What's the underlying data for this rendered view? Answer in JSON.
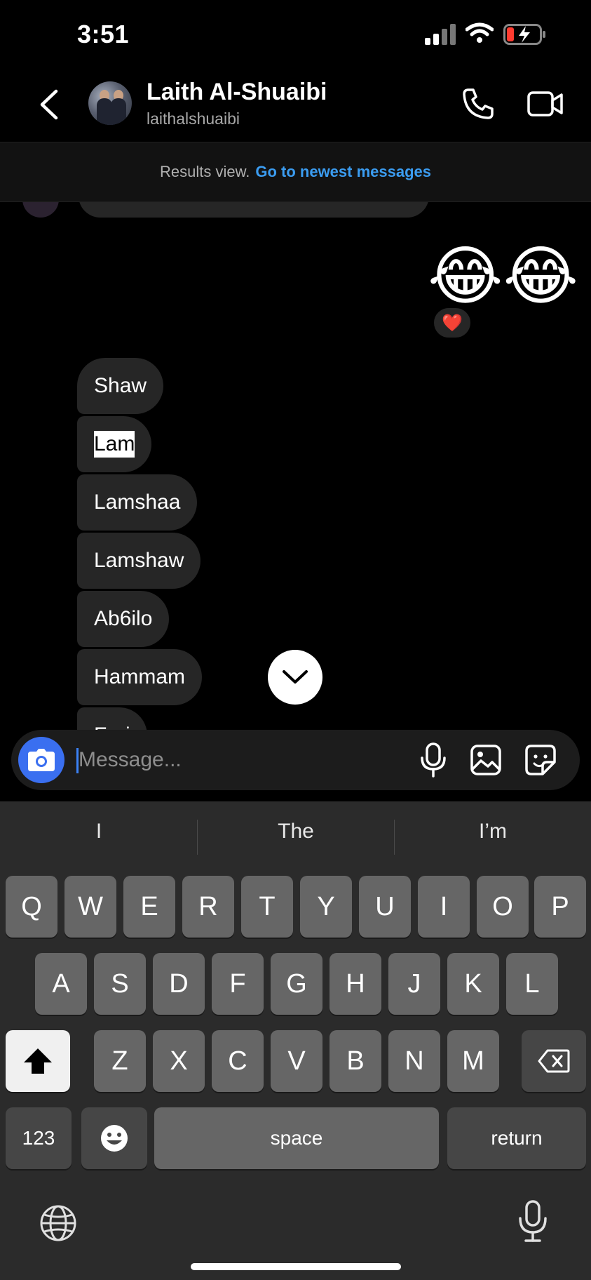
{
  "status_bar": {
    "time": "3:51"
  },
  "header": {
    "name": "Laith Al-Shuaibi",
    "handle": "laithalshuaibi"
  },
  "banner": {
    "text": "Results view.",
    "link": "Go to newest messages"
  },
  "chat": {
    "emoji_message": "😂😂",
    "reaction": "❤️",
    "messages": [
      "Shaw",
      "Lam",
      "Lamshaa",
      "Lamshaw",
      "Ab6ilo",
      "Hammam",
      "Fari"
    ],
    "selected_message_index": 1
  },
  "composer": {
    "placeholder": "Message..."
  },
  "keyboard": {
    "suggestions": [
      "I",
      "The",
      "I’m"
    ],
    "row1": [
      "Q",
      "W",
      "E",
      "R",
      "T",
      "Y",
      "U",
      "I",
      "O",
      "P"
    ],
    "row2": [
      "A",
      "S",
      "D",
      "F",
      "G",
      "H",
      "J",
      "K",
      "L"
    ],
    "row3": [
      "Z",
      "X",
      "C",
      "V",
      "B",
      "N",
      "M"
    ],
    "numbers_label": "123",
    "space_label": "space",
    "return_label": "return"
  },
  "colors": {
    "accent_link": "#3b9cf0",
    "camera_button": "#3a6ff0",
    "bubble": "#262626",
    "keyboard_bg": "#2b2b2b"
  }
}
